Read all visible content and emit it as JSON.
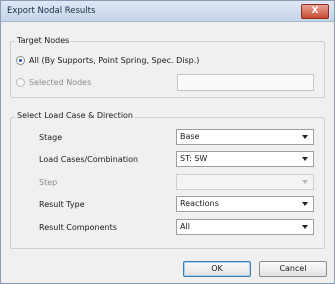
{
  "window": {
    "title": "Export Nodal Results",
    "close_label": "X"
  },
  "target_nodes": {
    "legend": "Target Nodes",
    "all_label": "All (By Supports, Point Spring, Spec. Disp.)",
    "selected_label": "Selected Nodes",
    "selected_value": ""
  },
  "load_case": {
    "legend": "Select Load Case & Direction",
    "fields": {
      "stage": {
        "label": "Stage",
        "value": "Base"
      },
      "load_cases": {
        "label": "Load Cases/Combination",
        "value": "ST: SW"
      },
      "step": {
        "label": "Step",
        "value": ""
      },
      "result_type": {
        "label": "Result Type",
        "value": "Reactions"
      },
      "result_components": {
        "label": "Result Components",
        "value": "All"
      }
    }
  },
  "buttons": {
    "ok": "OK",
    "cancel": "Cancel"
  }
}
